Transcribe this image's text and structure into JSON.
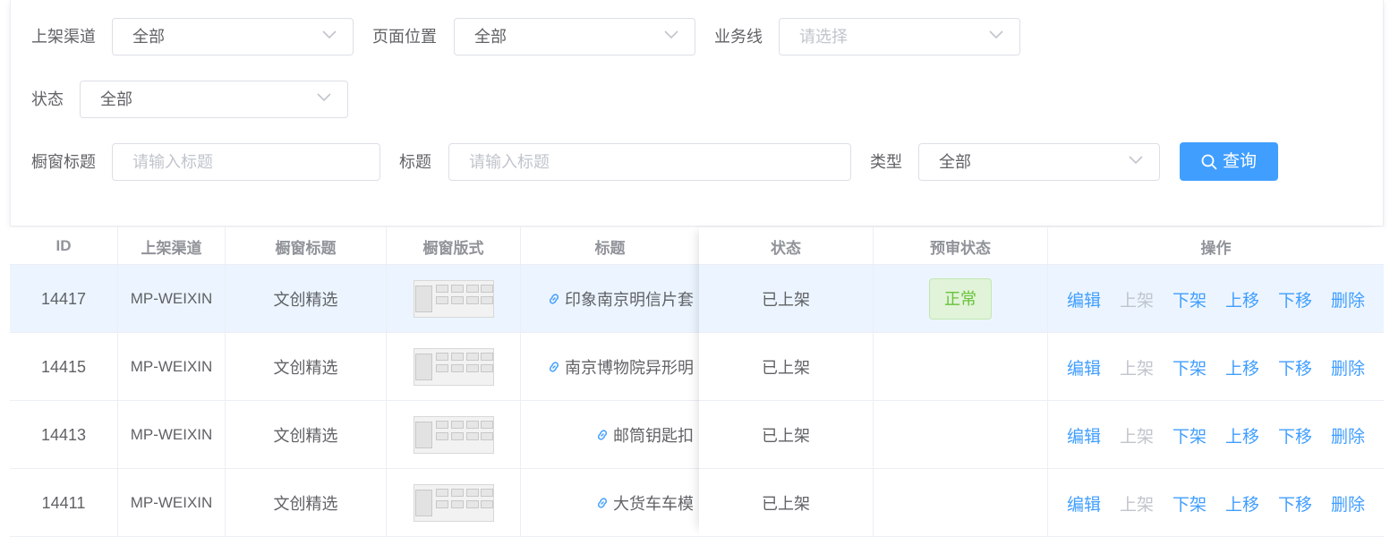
{
  "filters": {
    "channel": {
      "label": "上架渠道",
      "value": "全部"
    },
    "position": {
      "label": "页面位置",
      "value": "全部"
    },
    "business": {
      "label": "业务线",
      "placeholder": "请选择"
    },
    "status": {
      "label": "状态",
      "value": "全部"
    },
    "window_title": {
      "label": "橱窗标题",
      "placeholder": "请输入标题"
    },
    "title": {
      "label": "标题",
      "placeholder": "请输入标题"
    },
    "type": {
      "label": "类型",
      "value": "全部"
    },
    "query_label": "查询"
  },
  "table": {
    "headers": [
      "ID",
      "上架渠道",
      "橱窗标题",
      "橱窗版式",
      "标题",
      "状态",
      "预审状态",
      "操作"
    ],
    "rows": [
      {
        "id": "14417",
        "channel": "MP-WEIXIN",
        "window_title": "文创精选",
        "title": "印象南京明信片套",
        "status": "已上架",
        "review": "正常"
      },
      {
        "id": "14415",
        "channel": "MP-WEIXIN",
        "window_title": "文创精选",
        "title": "南京博物院异形明",
        "status": "已上架",
        "review": ""
      },
      {
        "id": "14413",
        "channel": "MP-WEIXIN",
        "window_title": "文创精选",
        "title": "邮筒钥匙扣",
        "status": "已上架",
        "review": ""
      },
      {
        "id": "14411",
        "channel": "MP-WEIXIN",
        "window_title": "文创精选",
        "title": "大货车车模",
        "status": "已上架",
        "review": ""
      }
    ],
    "actions": {
      "edit": "编辑",
      "list": "上架",
      "delist": "下架",
      "move_up": "上移",
      "move_down": "下移",
      "delete": "删除"
    }
  },
  "colors": {
    "primary": "#409eff",
    "success": "#67c23a",
    "disabled": "#c0c4cc",
    "row_highlight": "#ecf5ff"
  }
}
